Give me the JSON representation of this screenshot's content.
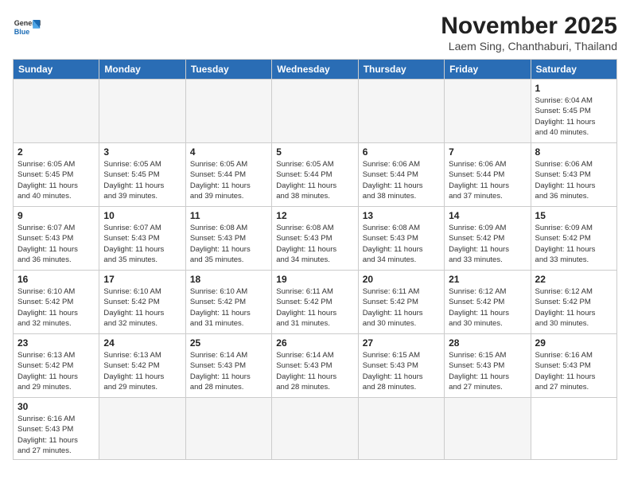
{
  "header": {
    "logo_general": "General",
    "logo_blue": "Blue",
    "month_title": "November 2025",
    "location": "Laem Sing, Chanthaburi, Thailand"
  },
  "weekdays": [
    "Sunday",
    "Monday",
    "Tuesday",
    "Wednesday",
    "Thursday",
    "Friday",
    "Saturday"
  ],
  "days": [
    {
      "num": "",
      "info": "",
      "empty": true
    },
    {
      "num": "",
      "info": "",
      "empty": true
    },
    {
      "num": "",
      "info": "",
      "empty": true
    },
    {
      "num": "",
      "info": "",
      "empty": true
    },
    {
      "num": "",
      "info": "",
      "empty": true
    },
    {
      "num": "",
      "info": "",
      "empty": true
    },
    {
      "num": "1",
      "info": "Sunrise: 6:04 AM\nSunset: 5:45 PM\nDaylight: 11 hours\nand 40 minutes."
    },
    {
      "num": "2",
      "info": "Sunrise: 6:05 AM\nSunset: 5:45 PM\nDaylight: 11 hours\nand 40 minutes."
    },
    {
      "num": "3",
      "info": "Sunrise: 6:05 AM\nSunset: 5:45 PM\nDaylight: 11 hours\nand 39 minutes."
    },
    {
      "num": "4",
      "info": "Sunrise: 6:05 AM\nSunset: 5:44 PM\nDaylight: 11 hours\nand 39 minutes."
    },
    {
      "num": "5",
      "info": "Sunrise: 6:05 AM\nSunset: 5:44 PM\nDaylight: 11 hours\nand 38 minutes."
    },
    {
      "num": "6",
      "info": "Sunrise: 6:06 AM\nSunset: 5:44 PM\nDaylight: 11 hours\nand 38 minutes."
    },
    {
      "num": "7",
      "info": "Sunrise: 6:06 AM\nSunset: 5:44 PM\nDaylight: 11 hours\nand 37 minutes."
    },
    {
      "num": "8",
      "info": "Sunrise: 6:06 AM\nSunset: 5:43 PM\nDaylight: 11 hours\nand 36 minutes."
    },
    {
      "num": "9",
      "info": "Sunrise: 6:07 AM\nSunset: 5:43 PM\nDaylight: 11 hours\nand 36 minutes."
    },
    {
      "num": "10",
      "info": "Sunrise: 6:07 AM\nSunset: 5:43 PM\nDaylight: 11 hours\nand 35 minutes."
    },
    {
      "num": "11",
      "info": "Sunrise: 6:08 AM\nSunset: 5:43 PM\nDaylight: 11 hours\nand 35 minutes."
    },
    {
      "num": "12",
      "info": "Sunrise: 6:08 AM\nSunset: 5:43 PM\nDaylight: 11 hours\nand 34 minutes."
    },
    {
      "num": "13",
      "info": "Sunrise: 6:08 AM\nSunset: 5:43 PM\nDaylight: 11 hours\nand 34 minutes."
    },
    {
      "num": "14",
      "info": "Sunrise: 6:09 AM\nSunset: 5:42 PM\nDaylight: 11 hours\nand 33 minutes."
    },
    {
      "num": "15",
      "info": "Sunrise: 6:09 AM\nSunset: 5:42 PM\nDaylight: 11 hours\nand 33 minutes."
    },
    {
      "num": "16",
      "info": "Sunrise: 6:10 AM\nSunset: 5:42 PM\nDaylight: 11 hours\nand 32 minutes."
    },
    {
      "num": "17",
      "info": "Sunrise: 6:10 AM\nSunset: 5:42 PM\nDaylight: 11 hours\nand 32 minutes."
    },
    {
      "num": "18",
      "info": "Sunrise: 6:10 AM\nSunset: 5:42 PM\nDaylight: 11 hours\nand 31 minutes."
    },
    {
      "num": "19",
      "info": "Sunrise: 6:11 AM\nSunset: 5:42 PM\nDaylight: 11 hours\nand 31 minutes."
    },
    {
      "num": "20",
      "info": "Sunrise: 6:11 AM\nSunset: 5:42 PM\nDaylight: 11 hours\nand 30 minutes."
    },
    {
      "num": "21",
      "info": "Sunrise: 6:12 AM\nSunset: 5:42 PM\nDaylight: 11 hours\nand 30 minutes."
    },
    {
      "num": "22",
      "info": "Sunrise: 6:12 AM\nSunset: 5:42 PM\nDaylight: 11 hours\nand 30 minutes."
    },
    {
      "num": "23",
      "info": "Sunrise: 6:13 AM\nSunset: 5:42 PM\nDaylight: 11 hours\nand 29 minutes."
    },
    {
      "num": "24",
      "info": "Sunrise: 6:13 AM\nSunset: 5:42 PM\nDaylight: 11 hours\nand 29 minutes."
    },
    {
      "num": "25",
      "info": "Sunrise: 6:14 AM\nSunset: 5:43 PM\nDaylight: 11 hours\nand 28 minutes."
    },
    {
      "num": "26",
      "info": "Sunrise: 6:14 AM\nSunset: 5:43 PM\nDaylight: 11 hours\nand 28 minutes."
    },
    {
      "num": "27",
      "info": "Sunrise: 6:15 AM\nSunset: 5:43 PM\nDaylight: 11 hours\nand 28 minutes."
    },
    {
      "num": "28",
      "info": "Sunrise: 6:15 AM\nSunset: 5:43 PM\nDaylight: 11 hours\nand 27 minutes."
    },
    {
      "num": "29",
      "info": "Sunrise: 6:16 AM\nSunset: 5:43 PM\nDaylight: 11 hours\nand 27 minutes."
    },
    {
      "num": "30",
      "info": "Sunrise: 6:16 AM\nSunset: 5:43 PM\nDaylight: 11 hours\nand 27 minutes."
    },
    {
      "num": "",
      "info": "",
      "empty": true
    },
    {
      "num": "",
      "info": "",
      "empty": true
    },
    {
      "num": "",
      "info": "",
      "empty": true
    },
    {
      "num": "",
      "info": "",
      "empty": true
    },
    {
      "num": "",
      "info": "",
      "empty": true
    }
  ]
}
